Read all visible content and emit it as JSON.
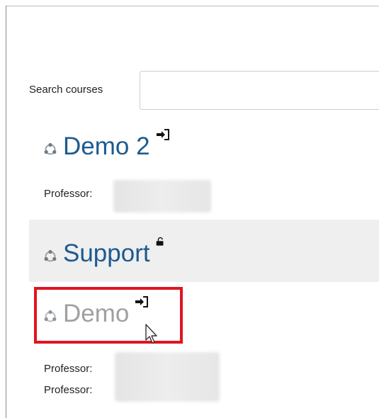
{
  "search": {
    "label": "Search courses",
    "value": "",
    "placeholder": ""
  },
  "courses": [
    {
      "title": "Demo 2",
      "professors": [
        "Professor:"
      ],
      "badge_icon": "enrol-icon",
      "style": "normal"
    },
    {
      "title": "Support",
      "professors": [],
      "badge_icon": "unlocked-icon",
      "style": "shaded"
    },
    {
      "title": "Demo",
      "professors": [
        "Professor:",
        "Professor:"
      ],
      "badge_icon": "enrol-icon",
      "style": "dimmed-highlighted"
    }
  ],
  "colors": {
    "link": "#1d5a8f",
    "dimmed_link": "#a0a0a0",
    "highlight": "#e0141e",
    "shaded_row": "#efefef"
  }
}
